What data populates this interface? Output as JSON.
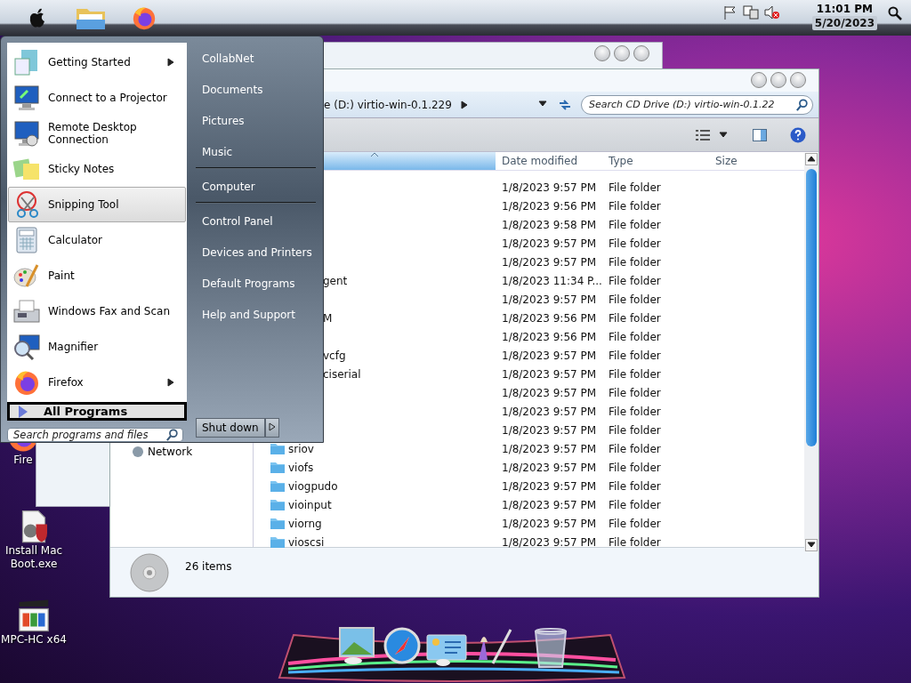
{
  "menu_bar": {
    "time": "11:01 PM",
    "date": "5/20/2023"
  },
  "desktop_icons": [
    {
      "kind": "firefox",
      "label": "Fire"
    },
    {
      "kind": "installer",
      "label": "Install Mac Boot.exe"
    },
    {
      "kind": "player",
      "label": "MPC-HC x64"
    }
  ],
  "explorer": {
    "breadcrumb": "e (D:) virtio-win-0.1.229",
    "search_placeholder": "Search CD Drive (D:) virtio-win-0.1.22",
    "columns": [
      "Date modified",
      "Type",
      "Size"
    ],
    "nav": [
      "Network"
    ],
    "rows": [
      {
        "date": "1/8/2023 9:57 PM",
        "type": "File folder"
      },
      {
        "date": "1/8/2023 9:56 PM",
        "type": "File folder"
      },
      {
        "date": "1/8/2023 9:58 PM",
        "type": "File folder"
      },
      {
        "date": "1/8/2023 9:57 PM",
        "type": "File folder"
      },
      {
        "date": "1/8/2023 9:57 PM",
        "type": "File folder"
      },
      {
        "name": "gent",
        "clipped": true,
        "date": "1/8/2023 11:34 P...",
        "type": "File folder"
      },
      {
        "date": "1/8/2023 9:57 PM",
        "type": "File folder"
      },
      {
        "name": "M",
        "clipped": true,
        "date": "1/8/2023 9:56 PM",
        "type": "File folder"
      },
      {
        "date": "1/8/2023 9:56 PM",
        "type": "File folder"
      },
      {
        "name": "vcfg",
        "clipped": true,
        "date": "1/8/2023 9:57 PM",
        "type": "File folder"
      },
      {
        "name": "ciserial",
        "clipped": true,
        "date": "1/8/2023 9:57 PM",
        "type": "File folder"
      },
      {
        "date": "1/8/2023 9:57 PM",
        "type": "File folder"
      },
      {
        "date": "1/8/2023 9:57 PM",
        "type": "File folder"
      },
      {
        "date": "1/8/2023 9:57 PM",
        "type": "File folder"
      },
      {
        "name": "sriov",
        "clipped": false,
        "date": "1/8/2023 9:57 PM",
        "type": "File folder"
      },
      {
        "name": "viofs",
        "clipped": false,
        "date": "1/8/2023 9:57 PM",
        "type": "File folder"
      },
      {
        "name": "viogpudo",
        "clipped": false,
        "date": "1/8/2023 9:57 PM",
        "type": "File folder"
      },
      {
        "name": "vioinput",
        "clipped": false,
        "date": "1/8/2023 9:57 PM",
        "type": "File folder"
      },
      {
        "name": "viorng",
        "clipped": false,
        "date": "1/8/2023 9:57 PM",
        "type": "File folder"
      },
      {
        "name": "vioscsi",
        "clipped": false,
        "date": "1/8/2023 9:57 PM",
        "type": "File folder"
      }
    ],
    "status": "26 items"
  },
  "start_menu": {
    "programs": [
      {
        "kind": "getting-started",
        "label": "Getting Started",
        "submenu": true,
        "selected": false
      },
      {
        "kind": "projector",
        "label": "Connect to a Projector",
        "submenu": false,
        "selected": false
      },
      {
        "kind": "remote",
        "label": "Remote Desktop Connection",
        "submenu": false,
        "selected": false
      },
      {
        "kind": "notes",
        "label": "Sticky Notes",
        "submenu": false,
        "selected": false
      },
      {
        "kind": "snip",
        "label": "Snipping Tool",
        "submenu": false,
        "selected": true
      },
      {
        "kind": "calculator",
        "label": "Calculator",
        "submenu": false,
        "selected": false
      },
      {
        "kind": "paint",
        "label": "Paint",
        "submenu": false,
        "selected": false
      },
      {
        "kind": "fax",
        "label": "Windows Fax and Scan",
        "submenu": false,
        "selected": false
      },
      {
        "kind": "magnifier",
        "label": "Magnifier",
        "submenu": false,
        "selected": false
      },
      {
        "kind": "firefox",
        "label": "Firefox",
        "submenu": true,
        "selected": false
      }
    ],
    "all_programs": "All Programs",
    "search_placeholder": "Search programs and files",
    "places": [
      {
        "label": "CollabNet",
        "separator_after": false
      },
      {
        "label": "Documents",
        "separator_after": false
      },
      {
        "label": "Pictures",
        "separator_after": false
      },
      {
        "label": "Music",
        "separator_after": true
      },
      {
        "label": "Computer",
        "separator_after": true
      },
      {
        "label": "Control Panel",
        "separator_after": false
      },
      {
        "label": "Devices and Printers",
        "separator_after": false
      },
      {
        "label": "Default Programs",
        "separator_after": false
      },
      {
        "label": "Help and Support",
        "separator_after": false
      }
    ],
    "shutdown": "Shut down"
  }
}
